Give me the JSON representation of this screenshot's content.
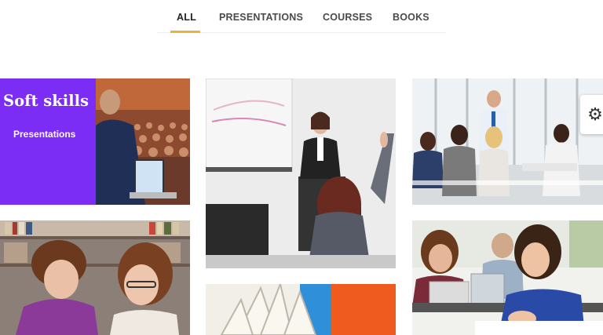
{
  "filters": {
    "tabs": [
      {
        "label": "ALL",
        "active": true
      },
      {
        "label": "PRESENTATIONS",
        "active": false
      },
      {
        "label": "COURSES",
        "active": false
      },
      {
        "label": "BOOKS",
        "active": false
      }
    ],
    "accent_color": "#e8b33a"
  },
  "portfolio": {
    "soft_skills": {
      "title": "Soft skills",
      "subtitle": "Presentations",
      "panel_color": "#7b2df5"
    }
  },
  "settings": {
    "icon": "gear-icon"
  }
}
